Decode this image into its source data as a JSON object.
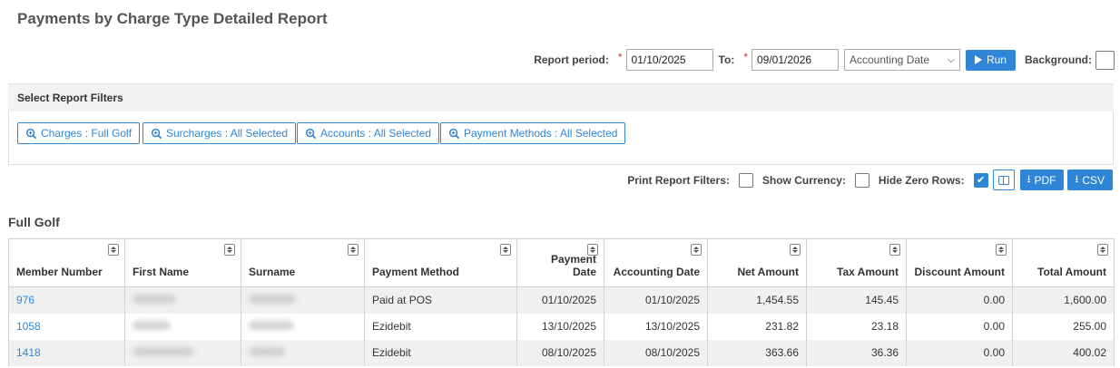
{
  "page": {
    "title": "Payments by Charge Type Detailed Report"
  },
  "period": {
    "label": "Report period:",
    "from": "01/10/2025",
    "to_label": "To:",
    "to": "09/01/2026",
    "date_type": "Accounting Date",
    "run_label": "Run",
    "background_label": "Background:"
  },
  "filters": {
    "heading": "Select Report Filters",
    "buttons": [
      {
        "label": "Charges : Full Golf"
      },
      {
        "label": "Surcharges : All Selected"
      },
      {
        "label": "Accounts : All Selected"
      },
      {
        "label": "Payment Methods : All Selected"
      }
    ]
  },
  "options": {
    "print_filters_label": "Print Report Filters:",
    "show_currency_label": "Show Currency:",
    "hide_zero_label": "Hide Zero Rows:",
    "print_filters_checked": false,
    "show_currency_checked": false,
    "hide_zero_checked": true,
    "pdf_label": "PDF",
    "csv_label": "CSV"
  },
  "section": {
    "title": "Full Golf"
  },
  "table": {
    "columns": [
      "Member Number",
      "First Name",
      "Surname",
      "Payment Method",
      "Payment Date",
      "Accounting Date",
      "Net Amount",
      "Tax Amount",
      "Discount Amount",
      "Total Amount"
    ],
    "rows": [
      {
        "member": "976",
        "payment_method": "Paid at POS",
        "payment_date": "01/10/2025",
        "accounting_date": "01/10/2025",
        "net": "1,454.55",
        "tax": "145.45",
        "discount": "0.00",
        "total": "1,600.00"
      },
      {
        "member": "1058",
        "payment_method": "Ezidebit",
        "payment_date": "13/10/2025",
        "accounting_date": "13/10/2025",
        "net": "231.82",
        "tax": "23.18",
        "discount": "0.00",
        "total": "255.00"
      },
      {
        "member": "1418",
        "payment_method": "Ezidebit",
        "payment_date": "08/10/2025",
        "accounting_date": "08/10/2025",
        "net": "363.66",
        "tax": "36.36",
        "discount": "0.00",
        "total": "400.02"
      }
    ]
  },
  "colors": {
    "accent": "#2f86d6",
    "required": "#c0392b"
  }
}
